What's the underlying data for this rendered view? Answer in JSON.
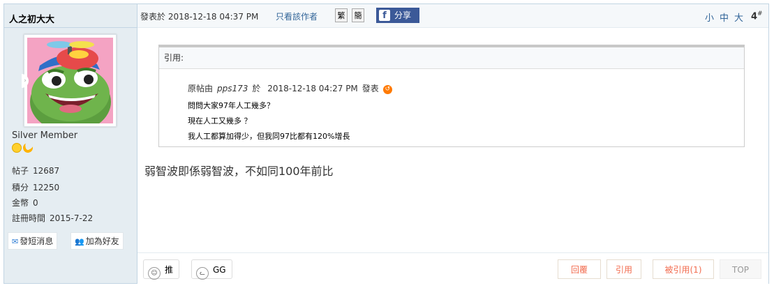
{
  "author": {
    "name": "人之初大大",
    "group": "Silver Member",
    "stats": [
      {
        "label": "帖子",
        "value": "12687"
      },
      {
        "label": "積分",
        "value": "12250"
      },
      {
        "label": "金幣",
        "value": "0"
      },
      {
        "label": "註冊時間",
        "value": "2015-7-22"
      }
    ],
    "send_message_label": "發短消息",
    "add_friend_label": "加為好友",
    "colors": {
      "panel": "#e5edf2",
      "border": "#c2d5e3"
    }
  },
  "header": {
    "posted_info": "發表於 2018-12-18 04:37 PM",
    "only_author_label": "只看該作者",
    "traditional_label": "繁",
    "simplified_label": "簡",
    "share_label": "分享",
    "font_small": "小",
    "font_medium": "中",
    "font_large": "大",
    "floor_number": "4",
    "floor_mark": "#"
  },
  "quote": {
    "header_label": "引用:",
    "orig_prefix": "原帖由",
    "orig_user": "pps173",
    "orig_at": "於",
    "orig_time": "2018-12-18 04:27 PM",
    "orig_suffix": "發表",
    "lines": [
      "問問大家97年人工幾多？",
      "現在人工又幾多 ？",
      "我人工都算加得少，但我同97比都有120%增長"
    ]
  },
  "message": "弱智波即係弱智波，不如同100年前比",
  "footer": {
    "vote_up_label": "推",
    "vote_gg_label": "GG",
    "reply_label": "回覆",
    "quote_label": "引用",
    "quoted_by_label": "被引用(1)",
    "top_label": "TOP",
    "accent_color": "#f26c4f"
  }
}
